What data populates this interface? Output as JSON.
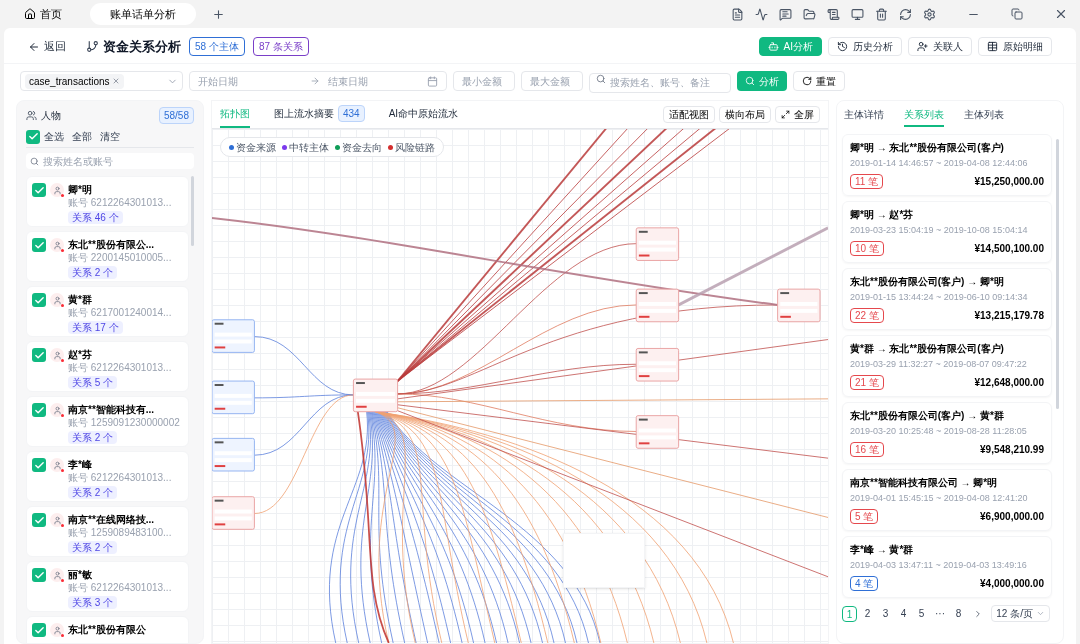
{
  "window_tabs": [
    {
      "label": "首页",
      "kind": "home",
      "selected": false
    },
    {
      "label": "账单话单分析",
      "kind": "page",
      "selected": true
    }
  ],
  "header": {
    "back": "返回",
    "title": "资金关系分析",
    "badges": [
      {
        "text": "58 个主体",
        "color": "#2f6fd6"
      },
      {
        "text": "87 条关系",
        "color": "#7a3fc8"
      }
    ],
    "buttons": [
      {
        "label": "AI分析",
        "kind": "primary"
      },
      {
        "label": "历史分析",
        "kind": "history"
      },
      {
        "label": "关联人",
        "kind": "person"
      },
      {
        "label": "原始明细",
        "kind": "table"
      }
    ]
  },
  "filters": {
    "dataset_tag": "case_transactions",
    "start_placeholder": "开始日期",
    "end_placeholder": "结束日期",
    "min_placeholder": "最小金额",
    "max_placeholder": "最大金额",
    "search_placeholder": "搜索姓名、账号、备注",
    "analyze": "分析",
    "reset": "重置"
  },
  "people_panel": {
    "title": "人物",
    "count": "58/58",
    "select_all": {
      "label": "全选",
      "checked": true
    },
    "actions": [
      "全部",
      "清空"
    ],
    "search_placeholder": "搜索姓名或账号",
    "items": [
      {
        "name": "卿*明",
        "account": "账号 6212264301013...",
        "relations": "关系 46 个",
        "checked": true
      },
      {
        "name": "东北**股份有限公...",
        "account": "账号 2200145010005...",
        "relations": "关系 2 个",
        "checked": true
      },
      {
        "name": "黄*群",
        "account": "账号 6217001240014...",
        "relations": "关系 17 个",
        "checked": true
      },
      {
        "name": "赵*芬",
        "account": "账号 6212264301013...",
        "relations": "关系 5 个",
        "checked": true
      },
      {
        "name": "南京**智能科技有...",
        "account": "账号 1259091230000002",
        "relations": "关系 2 个",
        "checked": true
      },
      {
        "name": "李*峰",
        "account": "账号 6212264301013...",
        "relations": "关系 2 个",
        "checked": true
      },
      {
        "name": "南京**在线网络技...",
        "account": "账号 1259089483100...",
        "relations": "关系 2 个",
        "checked": true
      },
      {
        "name": "丽*敏",
        "account": "账号 6212264301013...",
        "relations": "关系 3 个",
        "checked": true
      },
      {
        "name": "东北**股份有限公",
        "checked": true
      }
    ]
  },
  "graph_panel": {
    "tabs": [
      {
        "label": "拓扑图",
        "selected": true
      },
      {
        "label": "图上流水摘要",
        "count": "434",
        "selected": false
      },
      {
        "label": "AI命中原始流水",
        "selected": false
      }
    ],
    "tools": [
      {
        "label": "适配视图",
        "kind": "plain"
      },
      {
        "label": "横向布局",
        "kind": "plain"
      },
      {
        "label": "全屏",
        "kind": "fullscreen"
      }
    ],
    "legend": [
      {
        "label": "资金来源",
        "color": "#2f6fd6"
      },
      {
        "label": "中转主体",
        "color": "#7c3aed"
      },
      {
        "label": "资金去向",
        "color": "#0f9d58"
      },
      {
        "label": "风险链路",
        "color": "#d32f2f"
      }
    ]
  },
  "relations_panel": {
    "tabs": [
      {
        "label": "主体详情",
        "selected": false
      },
      {
        "label": "关系列表",
        "selected": true
      },
      {
        "label": "主体列表",
        "selected": false
      }
    ],
    "items": [
      {
        "title": "卿*明 → 东北**股份有限公司(客户)",
        "period": "2019-01-14 14:46:57 ~ 2019-04-08 12:44:06",
        "count": "11 笔",
        "color": "#e5484d",
        "amount": "¥15,250,000.00"
      },
      {
        "title": "卿*明 → 赵*芬",
        "period": "2019-03-23 15:04:19 ~ 2019-10-08 15:04:14",
        "count": "10 笔",
        "color": "#e5484d",
        "amount": "¥14,500,100.00"
      },
      {
        "title": "东北**股份有限公司(客户) → 卿*明",
        "period": "2019-01-15 13:44:24 ~ 2019-06-10 09:14:34",
        "count": "22 笔",
        "color": "#e5484d",
        "amount": "¥13,215,179.78"
      },
      {
        "title": "黄*群 → 东北**股份有限公司(客户)",
        "period": "2019-03-29 11:32:27 ~ 2019-08-07 09:47:22",
        "count": "21 笔",
        "color": "#e5484d",
        "amount": "¥12,648,000.00"
      },
      {
        "title": "东北**股份有限公司(客户) → 黄*群",
        "period": "2019-03-20 10:25:48 ~ 2019-08-28 11:28:05",
        "count": "16 笔",
        "color": "#e5484d",
        "amount": "¥9,548,210.99"
      },
      {
        "title": "南京**智能科技有限公司 → 卿*明",
        "period": "2019-04-01 15:45:15 ~ 2019-04-08 12:41:20",
        "count": "5 笔",
        "color": "#e5484d",
        "amount": "¥6,900,000.00"
      },
      {
        "title": "李*峰 → 黄*群",
        "period": "2019-04-03 13:47:11 ~ 2019-04-03 13:49:16",
        "count": "4 笔",
        "color": "#2f6fd6",
        "amount": "¥4,000,000.00"
      }
    ],
    "pagination": {
      "pages": [
        {
          "label": "1",
          "selected": true
        },
        {
          "label": "2",
          "selected": false
        },
        {
          "label": "3",
          "selected": false
        },
        {
          "label": "4",
          "selected": false
        },
        {
          "label": "5",
          "selected": false
        },
        {
          "label": "···",
          "selected": false
        },
        {
          "label": "8",
          "selected": false
        }
      ],
      "page_size": "12 条/页"
    }
  }
}
